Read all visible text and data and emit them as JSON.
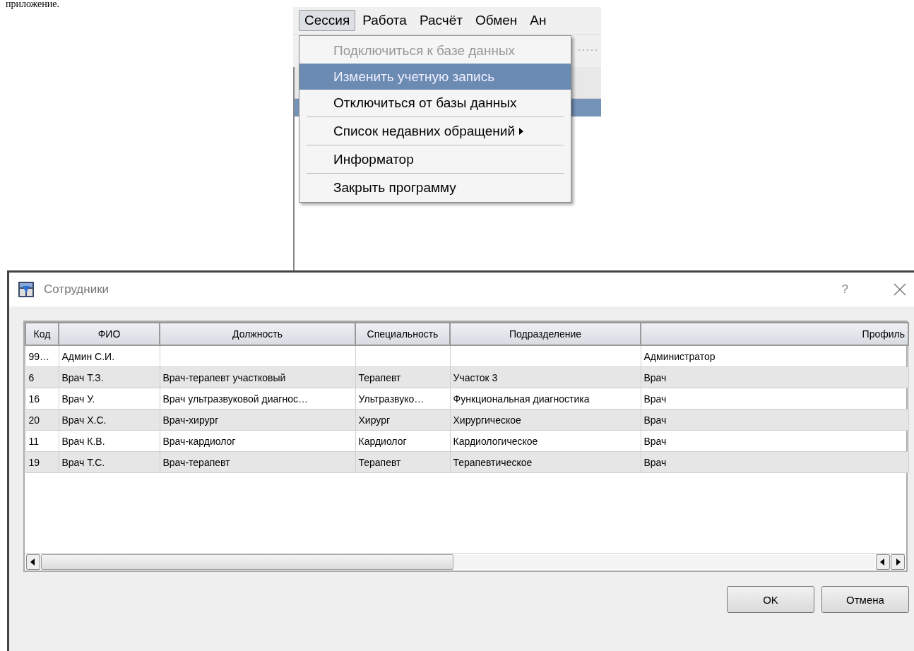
{
  "document_text": "приложение.",
  "menubar": {
    "items": [
      {
        "label": "Сессия",
        "selected": true
      },
      {
        "label": "Работа",
        "selected": false
      },
      {
        "label": "Расчёт",
        "selected": false
      },
      {
        "label": "Обмен",
        "selected": false
      },
      {
        "label": "Ан",
        "selected": false
      }
    ]
  },
  "session_menu": {
    "items": [
      {
        "label": "Подключиться к базе данных",
        "disabled": true,
        "selected": false,
        "separator_above": false,
        "submenu": false
      },
      {
        "label": "Изменить учетную запись",
        "disabled": false,
        "selected": true,
        "separator_above": false,
        "submenu": false
      },
      {
        "label": "Отключиться от базы данных",
        "disabled": false,
        "selected": false,
        "separator_above": false,
        "submenu": false
      },
      {
        "label": "Список недавних обращений",
        "disabled": false,
        "selected": false,
        "separator_above": true,
        "submenu": true
      },
      {
        "label": "Информатор",
        "disabled": false,
        "selected": false,
        "separator_above": true,
        "submenu": false
      },
      {
        "label": "Закрыть программу",
        "disabled": false,
        "selected": false,
        "separator_above": true,
        "submenu": false
      }
    ]
  },
  "dialog": {
    "title": "Сотрудники",
    "help": "?",
    "table": {
      "columns": [
        "Код",
        "ФИО",
        "Должность",
        "Специальность",
        "Подразделение",
        "Профиль"
      ],
      "rows": [
        [
          "99…",
          "Админ С.И.",
          "",
          "",
          "",
          "Администратор"
        ],
        [
          "6",
          "Врач Т.З.",
          "Врач-терапевт участковый",
          "Терапевт",
          "Участок 3",
          "Врач"
        ],
        [
          "16",
          "Врач У.",
          "Врач ультразвуковой диагнос…",
          "Ультразвуко…",
          "Функциональная диагностика",
          "Врач"
        ],
        [
          "20",
          "Врач Х.С.",
          "Врач-хирург",
          "Хирург",
          "Хирургическое",
          "Врач"
        ],
        [
          "11",
          "Врач К.В.",
          "Врач-кардиолог",
          "Кардиолог",
          "Кардиологическое",
          "Врач"
        ],
        [
          "19",
          "Врач Т.С.",
          "Врач-терапевт",
          "Терапевт",
          "Терапевтическое",
          "Врач"
        ]
      ]
    },
    "buttons": [
      "OK",
      "Отмена"
    ]
  }
}
